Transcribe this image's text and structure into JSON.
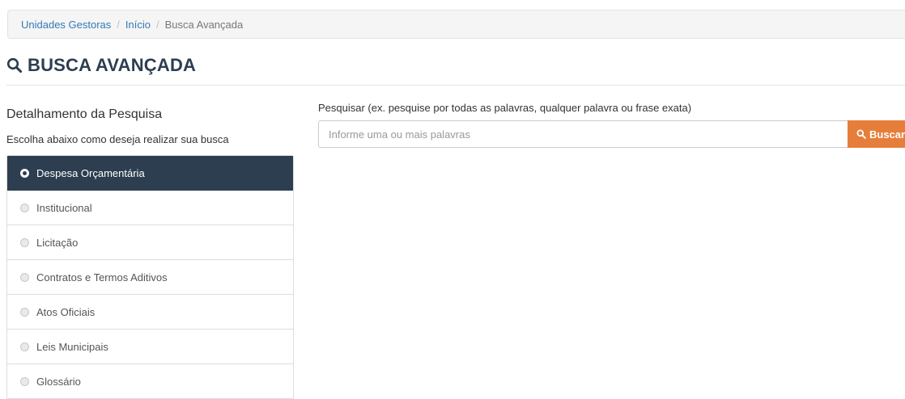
{
  "breadcrumb": {
    "items": [
      "Unidades Gestoras",
      "Início"
    ],
    "current": "Busca Avançada"
  },
  "page": {
    "title": "BUSCA AVANÇADA",
    "title_icon": "search-icon"
  },
  "sidebar": {
    "heading": "Detalhamento da Pesquisa",
    "subheading": "Escolha abaixo como deseja realizar sua busca",
    "selected": "Despesa Orçamentária",
    "items": [
      {
        "label": "Despesa Orçamentária"
      },
      {
        "label": "Institucional"
      },
      {
        "label": "Licitação"
      },
      {
        "label": "Contratos e Termos Aditivos"
      },
      {
        "label": "Atos Oficiais"
      },
      {
        "label": "Leis Municipais"
      },
      {
        "label": "Glossário"
      }
    ]
  },
  "search": {
    "label": "Pesquisar (ex. pesquise por todas as palavras, qualquer palavra ou frase exata)",
    "value": "",
    "placeholder": "Informe uma ou mais palavras",
    "button_label": "Buscar",
    "button_icon": "search-icon"
  },
  "colors": {
    "link": "#337ab7",
    "heading": "#2c3e50",
    "active_item_bg": "#2c3e50",
    "button_bg": "#e67e3b"
  }
}
